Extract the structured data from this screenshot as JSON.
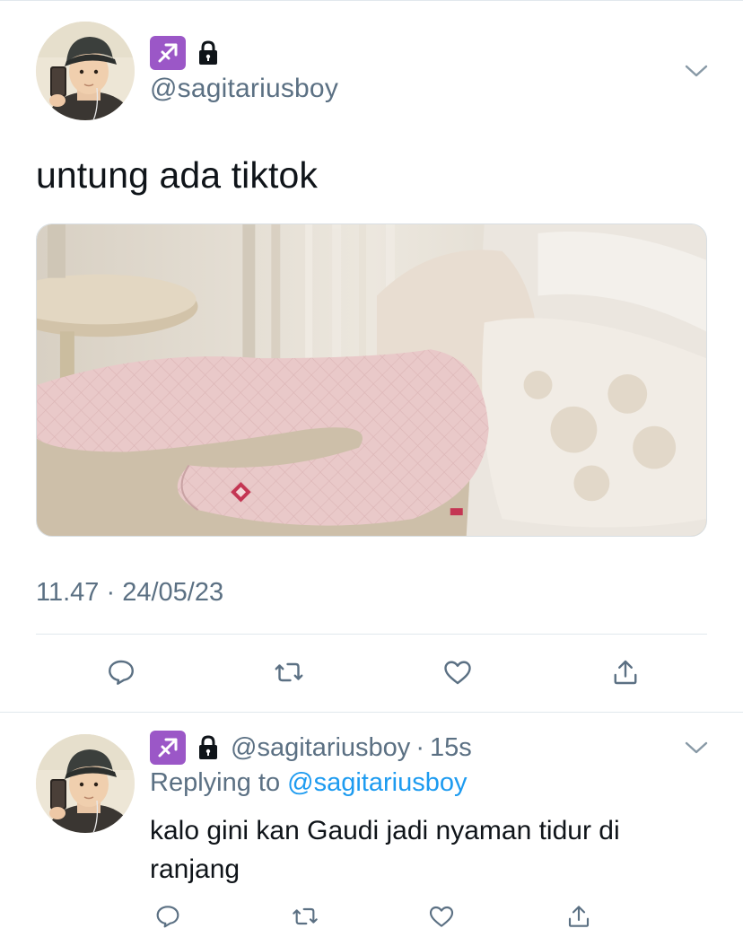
{
  "colors": {
    "text_primary": "#0f1419",
    "text_secondary": "#5b7083",
    "link": "#1d9bf0",
    "divider": "#e1e8ed",
    "zodiac_badge": "#9b57c7"
  },
  "main_tweet": {
    "badges": [
      "sagittarius-icon",
      "lock-icon"
    ],
    "handle": "@sagitariusboy",
    "text": "untung ada tiktok",
    "timestamp": "11.47 · 24/05/23",
    "media_icon": "photo-pillow",
    "actions": [
      "reply-icon",
      "retweet-icon",
      "like-icon",
      "share-icon"
    ]
  },
  "reply_tweet": {
    "badges": [
      "sagittarius-icon",
      "lock-icon"
    ],
    "handle": "@sagitariusboy",
    "separator": "·",
    "time_ago": "15s",
    "replying_prefix": "Replying to",
    "replying_to": "@sagitariusboy",
    "text": "kalo gini kan Gaudi jadi nyaman tidur di ranjang",
    "actions": [
      "reply-icon",
      "retweet-icon",
      "like-icon",
      "share-icon"
    ]
  }
}
